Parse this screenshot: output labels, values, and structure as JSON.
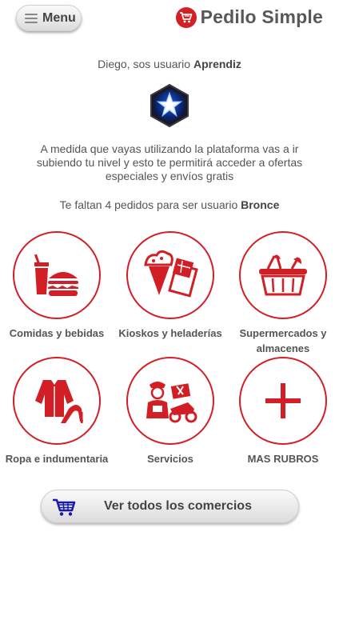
{
  "header": {
    "menu_label": "Menu",
    "brand_name": "Pedilo Simple",
    "brand_color": "#d32027"
  },
  "profile": {
    "greeting_prefix": "Diego, sos usuario ",
    "level": "Aprendiz",
    "badge_icon": "star-badge-icon",
    "info_text": "A medida que vayas utilizando la plataforma vas a ir subiendo tu nivel y esto te permitirá acceder a ofertas especiales y envíos gratis",
    "remaining_prefix": "Te faltan 4 pedidos para ser usuario ",
    "next_level": "Bronce"
  },
  "categories": [
    {
      "label": "Comidas y bebidas",
      "icon": "food-drink-icon"
    },
    {
      "label": "Kioskos y heladerías",
      "icon": "icecream-chocolate-icon"
    },
    {
      "label": "Supermercados y almacenes",
      "icon": "grocery-basket-icon"
    },
    {
      "label": "Ropa e indumentaria",
      "icon": "clothing-icon"
    },
    {
      "label": "Servicios",
      "icon": "delivery-service-icon"
    },
    {
      "label": "MAS RUBROS",
      "icon": "plus-icon"
    }
  ],
  "view_all": {
    "label": "Ver todos los comercios",
    "icon": "cart-icon"
  },
  "colors": {
    "accent": "#d21f26",
    "cart_blue": "#1a1aa8"
  }
}
